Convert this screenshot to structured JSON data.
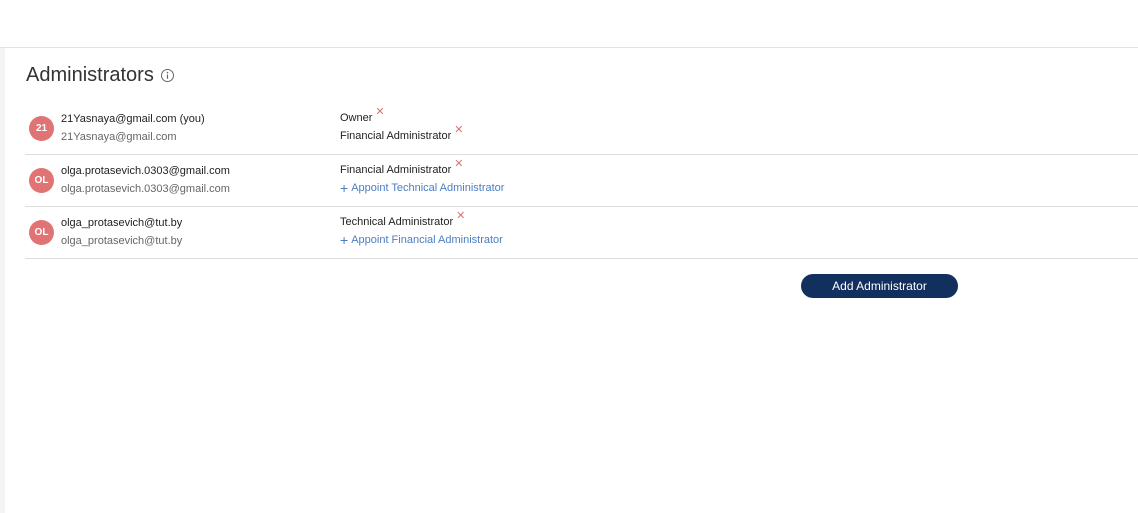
{
  "section": {
    "title": "Administrators",
    "info_icon": "info-circle-icon"
  },
  "admins": [
    {
      "initials": "21",
      "primary": "21Yasnaya@gmail.com (you)",
      "secondary": "21Yasnaya@gmail.com",
      "roles": [
        "Owner",
        "Financial Administrator"
      ],
      "appoint": ""
    },
    {
      "initials": "OL",
      "primary": "olga.protasevich.0303@gmail.com",
      "secondary": "olga.protasevich.0303@gmail.com",
      "roles": [
        "Financial Administrator"
      ],
      "appoint": "Appoint Technical Administrator"
    },
    {
      "initials": "OL",
      "primary": "olga_protasevich@tut.by",
      "secondary": "olga_protasevich@tut.by",
      "roles": [
        "Technical Administrator"
      ],
      "appoint": "Appoint Financial Administrator"
    }
  ],
  "actions": {
    "add_label": "Add Administrator"
  },
  "colors": {
    "avatar": "#e07373",
    "remove": "#e07373",
    "link": "#4a7ec2",
    "button": "#12305e"
  },
  "symbols": {
    "remove": "✕",
    "plus": "+"
  }
}
